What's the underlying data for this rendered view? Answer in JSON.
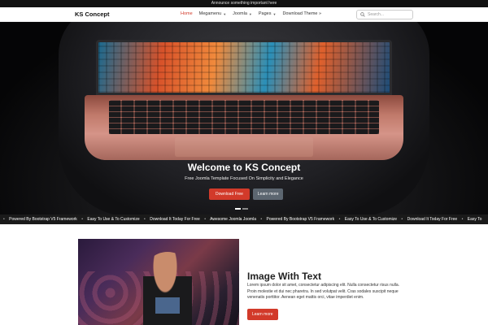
{
  "announcement": "Announce something important here",
  "header": {
    "logo": "KS Concept",
    "nav": [
      {
        "label": "Home",
        "active": true,
        "has_caret": false
      },
      {
        "label": "Megamenu",
        "active": false,
        "has_caret": true
      },
      {
        "label": "Joomla",
        "active": false,
        "has_caret": true
      },
      {
        "label": "Pages",
        "active": false,
        "has_caret": true
      },
      {
        "label": "Download Theme »",
        "active": false,
        "has_caret": false
      }
    ],
    "search_placeholder": "Search..."
  },
  "hero": {
    "title": "Welcome to KS Concept",
    "subtitle": "Free Joomla Template Focused On Simplicity and Elegance",
    "primary_button": "Download Free",
    "secondary_button": "Learn more",
    "slide_count": 2,
    "active_slide": 0
  },
  "ticker": [
    "Powered By Bootstrap V5 Framework",
    "Easy To Use & To Customize",
    "Download It Today For Free",
    "Awesome Joomla Joomla",
    "Powered By Bootstrap V5 Framework",
    "Easy To Use & To Customize",
    "Download It Today For Free",
    "Easy To"
  ],
  "feature": {
    "title": "Image With Text",
    "body": "Lorem ipsum dolor sit amet, consectetur adipiscing elit. Nulla consectetur risus nulla. Proin molestie et dui nec pharetra. In sed volutpat velit. Cras sodales suscipit neque venenatis porttitor. Aenean eget mattis orci, vitae imperdiet enim.",
    "button": "Learn more"
  },
  "colors": {
    "accent": "#d23a2a",
    "dark": "#111111"
  }
}
